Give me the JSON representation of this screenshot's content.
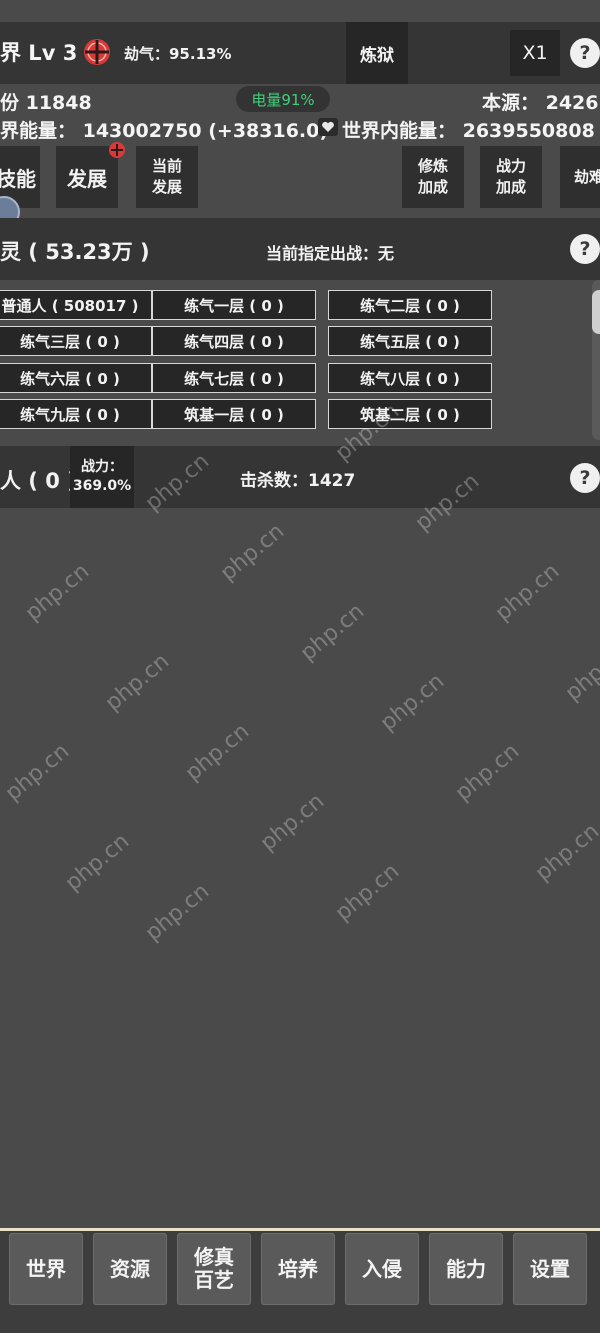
{
  "header": {
    "title": "界 Lv 3",
    "tribulation": "劫气：95.13%",
    "lianyu_label": "炼狱",
    "speed_label": "X1",
    "help_label": "?"
  },
  "status": {
    "shares": "份 11848",
    "source": "本源： 2426",
    "battery": "电量91%",
    "world_energy": "界能量： 143002750 (+38316.0)",
    "inner_energy": "世界内能量： 2639550808"
  },
  "nav": {
    "skills": "技能",
    "develop": "发展",
    "current_develop": [
      "当前",
      "发展"
    ],
    "cultivate_bonus": [
      "修炼",
      "加成"
    ],
    "power_bonus": [
      "战力",
      "加成"
    ],
    "partial": "劫难"
  },
  "spirit": {
    "title": "灵 ( 53.23万 )",
    "current_assigned": "当前指定出战：无",
    "cells": [
      "普通人 ( 508017 )",
      "练气一层 ( 0 )",
      "练气二层 ( 0 )",
      "练气三层 ( 0 )",
      "练气四层 ( 0 )",
      "练气五层 ( 0 )",
      "练气六层 ( 0 )",
      "练气七层 ( 0 )",
      "练气八层 ( 0 )",
      "练气九层 ( 0 )",
      "筑基一层 ( 0 )",
      "筑基二层 ( 0 )"
    ]
  },
  "enemy": {
    "title": "人 ( 0 )",
    "power_label": "战力：",
    "power_value": "369.0%",
    "kills": "击杀数：1427"
  },
  "tabs": [
    {
      "label": "世界"
    },
    {
      "label": "资源"
    },
    {
      "label": "修真百艺",
      "lines": [
        "修真",
        "百艺"
      ]
    },
    {
      "label": "培养"
    },
    {
      "label": "入侵"
    },
    {
      "label": "能力"
    },
    {
      "label": "设置"
    }
  ],
  "watermark": "php.cn",
  "colors": {
    "background": "#4a4a4a",
    "panel": "#353535",
    "button": "#262626",
    "battery_text": "#3fd07a",
    "bottom_border": "#e9e1c8",
    "alert_red": "#d83a3a"
  }
}
